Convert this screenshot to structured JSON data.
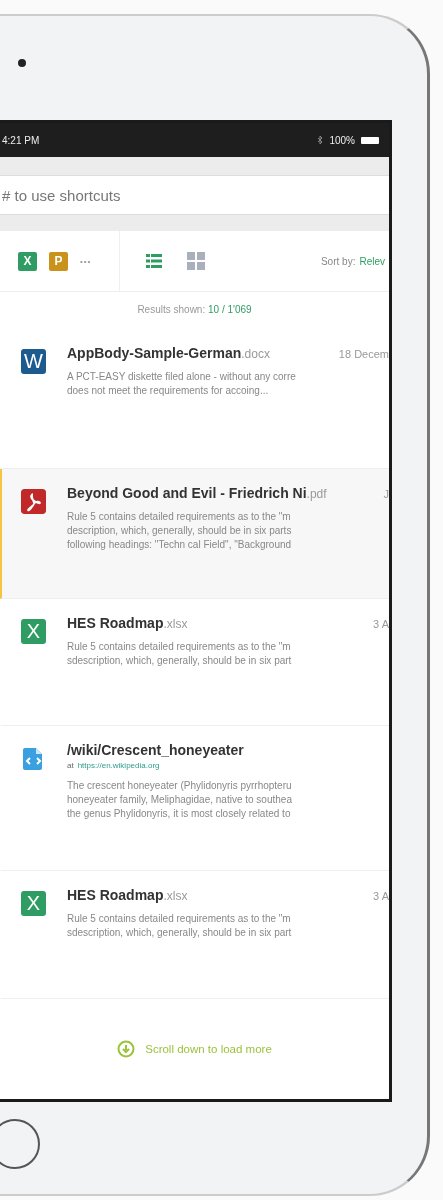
{
  "status_bar": {
    "time": "4:21 PM",
    "battery": "100%"
  },
  "search": {
    "placeholder": "# to use shortcuts"
  },
  "toolbar": {
    "filters": [
      {
        "kind": "excel",
        "label": "X"
      },
      {
        "kind": "powerpoint",
        "label": "P"
      }
    ],
    "more": "•••",
    "views": [
      {
        "kind": "list",
        "selected": true
      },
      {
        "kind": "grid",
        "selected": false
      }
    ],
    "sort_label": "Sort by:",
    "sort_value": "Relev"
  },
  "results_label": "Results shown:",
  "results_count": "10 / 1'069",
  "results": [
    {
      "kind": "word",
      "icon_letter": "W",
      "title": "AppBody-Sample-German",
      "ext": ".docx",
      "date": "18 Decem",
      "selected": false,
      "snippet": "A PCT-EASY diskette filed alone - without any corre\ndoes not meet the requirements for accoing..."
    },
    {
      "kind": "pdf",
      "title": "Beyond Good and Evil - Friedrich Ni",
      "ext": ".pdf",
      "date": "J",
      "selected": true,
      "snippet": "Rule 5 contains detailed requirements as to the \"m\ndescription, which, generally, should be in six parts\nfollowing headings: \"Techn cal Field\", \"Background"
    },
    {
      "kind": "excel",
      "icon_letter": "X",
      "title": "HES Roadmap",
      "ext": ".xlsx",
      "date": "3 A",
      "selected": false,
      "snippet": "Rule 5 contains detailed requirements as to the \"m\nsdescription, which, generally, should be in six part"
    },
    {
      "kind": "web",
      "title": "/wiki/Crescent_honeyeater",
      "source_prefix": "at",
      "source_link": "https://en.wikipedia.org",
      "selected": false,
      "snippet": "The crescent honeyeater (Phylidonyris pyrrhopteru\nhoneyeater family, Meliphagidae, native to southea\nthe genus Phylidonyris, it is most closely related to"
    },
    {
      "kind": "excel",
      "icon_letter": "X",
      "title": "HES Roadmap",
      "ext": ".xlsx",
      "date": "3 A",
      "selected": false,
      "snippet": "Rule 5 contains detailed requirements as to the \"m\nsdescription, which, generally, should be in six part"
    }
  ],
  "load_more": "Scroll down to load more"
}
